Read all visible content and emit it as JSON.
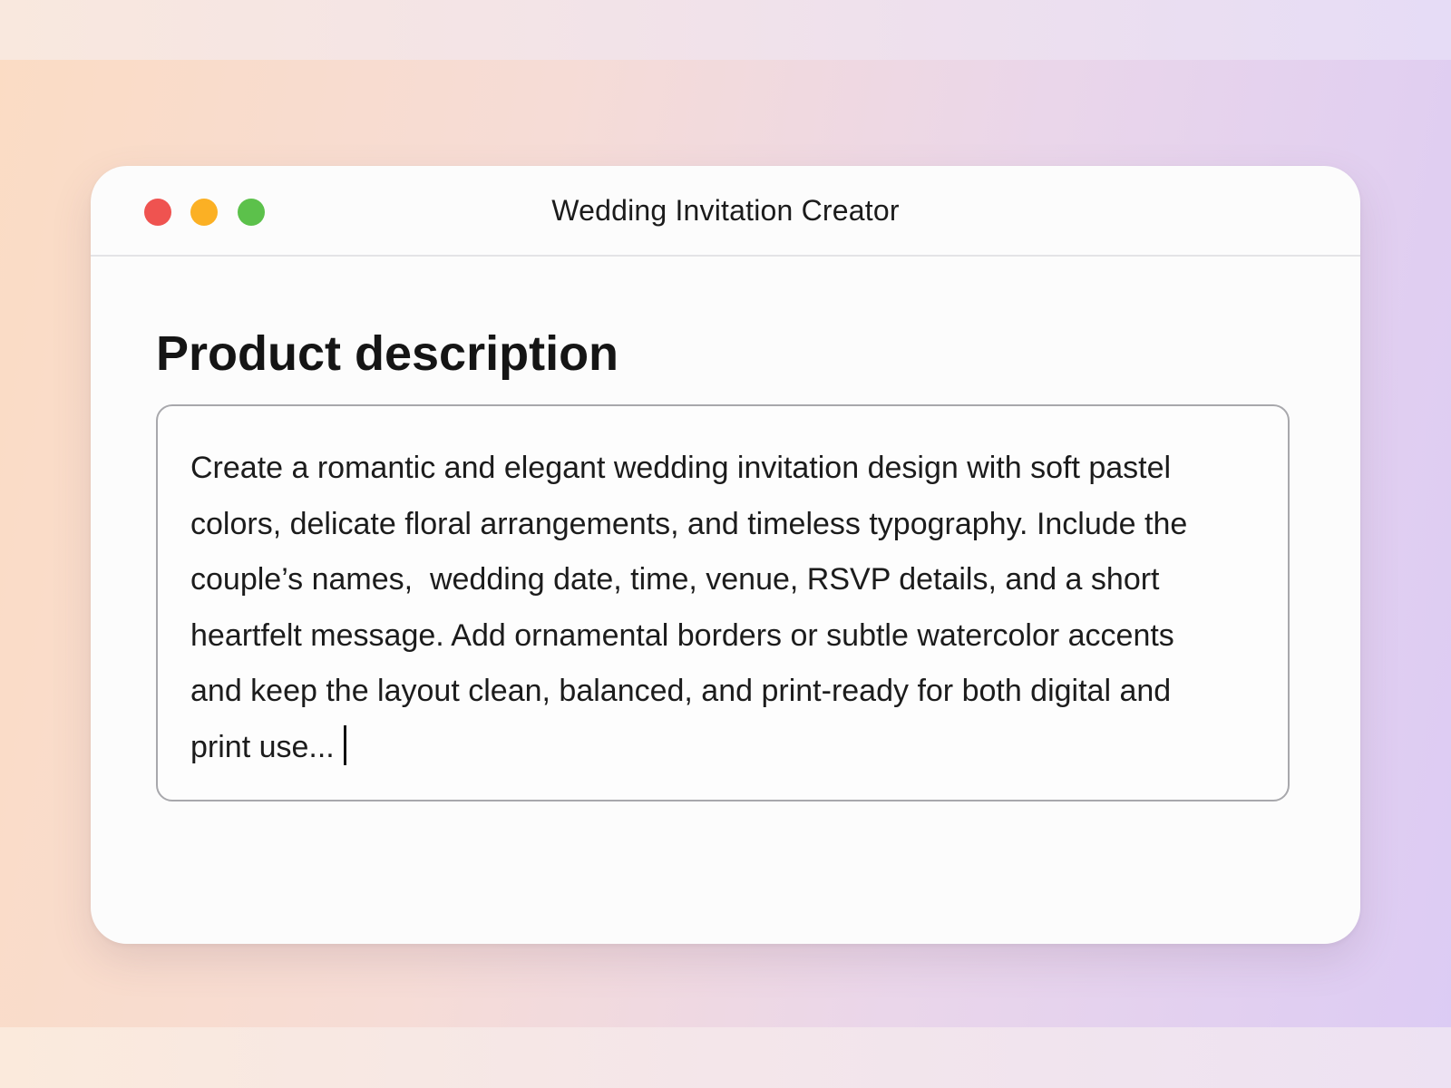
{
  "window": {
    "title": "Wedding Invitation Creator",
    "controls": [
      "close",
      "minimize",
      "zoom"
    ]
  },
  "section": {
    "heading": "Product description"
  },
  "description": {
    "lines": [
      "Create a romantic and elegant wedding invitation design with soft pastel",
      "colors, delicate floral arrangements, and timeless typography. Include the",
      "couple’s names,  wedding date, time, venue, RSVP details, and a short",
      "heartfelt message. Add ornamental borders or subtle watercolor accents",
      "and keep the layout clean, balanced, and print-ready for both digital and",
      "print use..."
    ]
  },
  "colors": {
    "close": "#ef5350",
    "minimize": "#fbb024",
    "zoom": "#5cc14b",
    "window_bg": "#fcfcfc"
  }
}
